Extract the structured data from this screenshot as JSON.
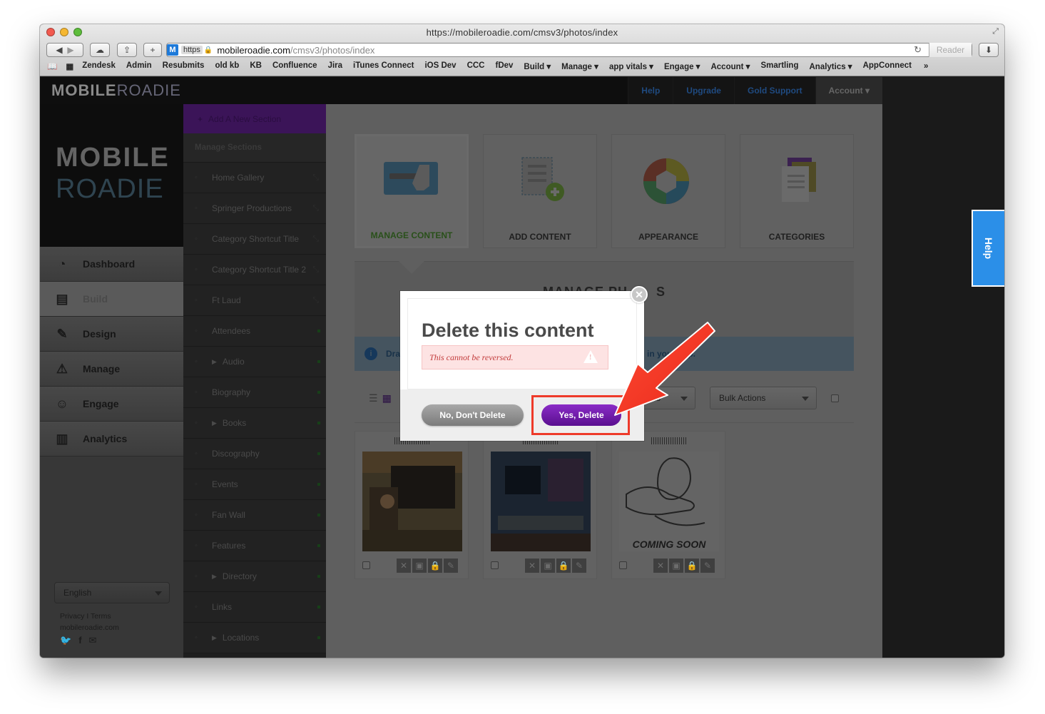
{
  "window": {
    "title": "https://mobileroadie.com/cmsv3/photos/index"
  },
  "address_bar": {
    "scheme": "https",
    "host": "mobileroadie.com",
    "path": "/cmsv3/photos/index",
    "reader": "Reader"
  },
  "bookmarks": [
    "Zendesk",
    "Admin",
    "Resubmits",
    "old kb",
    "KB",
    "Confluence",
    "Jira",
    "iTunes Connect",
    "iOS Dev",
    "CCC",
    "fDev",
    "Build ▾",
    "Manage ▾",
    "app vitals ▾",
    "Engage ▾",
    "Account ▾",
    "Smartling",
    "Analytics ▾",
    "AppConnect"
  ],
  "brand": {
    "part1": "MOBILE",
    "part2": "ROADIE"
  },
  "top_nav": {
    "help": "Help",
    "upgrade": "Upgrade",
    "gold_support": "Gold Support",
    "account": "Account ▾"
  },
  "help_tab": "Help",
  "logo": {
    "line1": "MOBILE",
    "line2": "ROADIE"
  },
  "left_nav": [
    {
      "label": "Dashboard",
      "icon": "gauge-icon"
    },
    {
      "label": "Build",
      "icon": "build-icon"
    },
    {
      "label": "Design",
      "icon": "pencil-icon"
    },
    {
      "label": "Manage",
      "icon": "manage-icon"
    },
    {
      "label": "Engage",
      "icon": "people-icon"
    },
    {
      "label": "Analytics",
      "icon": "bar-chart-icon"
    }
  ],
  "language": "English",
  "footer": {
    "privacy": "Privacy",
    "sep": "I",
    "terms": "Terms",
    "site": "mobileroadie.com"
  },
  "sections": {
    "add": "Add A New Section",
    "manage": "Manage Sections",
    "items": [
      {
        "label": "Home Gallery"
      },
      {
        "label": "Springer Productions"
      },
      {
        "label": "Category Shortcut Title"
      },
      {
        "label": "Category Shortcut Title 2"
      },
      {
        "label": "Ft Laud"
      },
      {
        "label": "Attendees"
      },
      {
        "label": "Audio",
        "expand": true
      },
      {
        "label": "Biography"
      },
      {
        "label": "Books",
        "expand": true
      },
      {
        "label": "Discography"
      },
      {
        "label": "Events"
      },
      {
        "label": "Fan Wall"
      },
      {
        "label": "Features"
      },
      {
        "label": "Directory",
        "expand": true
      },
      {
        "label": "Links"
      },
      {
        "label": "Locations",
        "expand": true
      }
    ]
  },
  "cards": [
    {
      "label": "MANAGE CONTENT",
      "active": true
    },
    {
      "label": "ADD CONTENT"
    },
    {
      "label": "APPEARANCE"
    },
    {
      "label": "CATEGORIES"
    }
  ],
  "panel": {
    "title_left": "MANAGE PH",
    "title_right": "S",
    "info_left": "Dra",
    "info_right": "in your app."
  },
  "toolbar": {
    "items_select_fragment": "ms",
    "bulk_actions": "Bulk Actions"
  },
  "photos": [
    {
      "caption": ""
    },
    {
      "caption": ""
    },
    {
      "caption": "COMING SOON"
    }
  ],
  "modal": {
    "title": "Delete this content",
    "warning": "This cannot be reversed.",
    "no_button": "No, Don't Delete",
    "yes_button": "Yes, Delete"
  },
  "colors": {
    "accent_purple": "#6a15a8",
    "annotation_red": "#ee3a2a",
    "help_blue": "#2b8fe8"
  }
}
